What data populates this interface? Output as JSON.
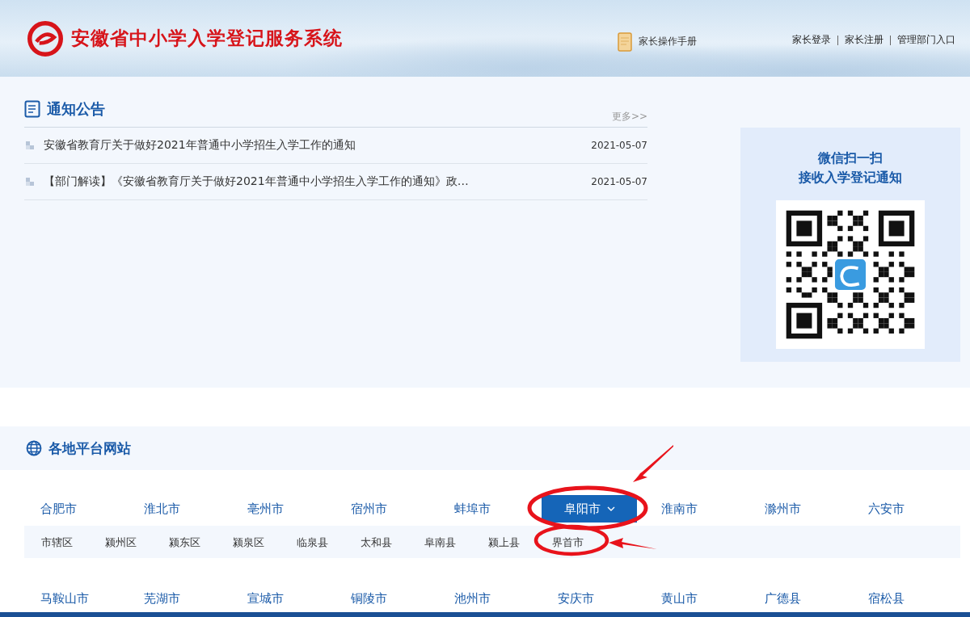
{
  "header": {
    "title": "安徽省中小学入学登记服务系统",
    "manual": "家长操作手册",
    "links": [
      "家长登录",
      "家长注册",
      "管理部门入口"
    ]
  },
  "notice": {
    "title": "通知公告",
    "more": "更多>>",
    "items": [
      {
        "title": "安徽省教育厅关于做好2021年普通中小学招生入学工作的通知",
        "date": "2021-05-07"
      },
      {
        "title": "【部门解读】《安徽省教育厅关于做好2021年普通中小学招生入学工作的通知》政…",
        "date": "2021-05-07"
      }
    ]
  },
  "qr": {
    "lines": [
      "微信扫一扫",
      "接收入学登记通知"
    ]
  },
  "regions": {
    "title": "各地平台网站",
    "rows": [
      {
        "cities": [
          {
            "name": "合肥市",
            "selected": false,
            "circled": false
          },
          {
            "name": "淮北市",
            "selected": false,
            "circled": false
          },
          {
            "name": "亳州市",
            "selected": false,
            "circled": false
          },
          {
            "name": "宿州市",
            "selected": false,
            "circled": false
          },
          {
            "name": "蚌埠市",
            "selected": false,
            "circled": false
          },
          {
            "name": "阜阳市",
            "selected": true,
            "circled": true
          },
          {
            "name": "淮南市",
            "selected": false,
            "circled": false
          },
          {
            "name": "滁州市",
            "selected": false,
            "circled": false
          },
          {
            "name": "六安市",
            "selected": false,
            "circled": false
          }
        ],
        "districts": [
          {
            "name": "市辖区",
            "circled": false
          },
          {
            "name": "颍州区",
            "circled": false
          },
          {
            "name": "颍东区",
            "circled": false
          },
          {
            "name": "颍泉区",
            "circled": false
          },
          {
            "name": "临泉县",
            "circled": false
          },
          {
            "name": "太和县",
            "circled": false
          },
          {
            "name": "阜南县",
            "circled": false
          },
          {
            "name": "颍上县",
            "circled": false
          },
          {
            "name": "界首市",
            "circled": true
          }
        ]
      },
      {
        "cities": [
          {
            "name": "马鞍山市",
            "selected": false,
            "circled": false
          },
          {
            "name": "芜湖市",
            "selected": false,
            "circled": false
          },
          {
            "name": "宣城市",
            "selected": false,
            "circled": false
          },
          {
            "name": "铜陵市",
            "selected": false,
            "circled": false
          },
          {
            "name": "池州市",
            "selected": false,
            "circled": false
          },
          {
            "name": "安庆市",
            "selected": false,
            "circled": false
          },
          {
            "name": "黄山市",
            "selected": false,
            "circled": false
          },
          {
            "name": "广德县",
            "selected": false,
            "circled": false
          },
          {
            "name": "宿松县",
            "selected": false,
            "circled": false
          }
        ],
        "districts": []
      }
    ]
  }
}
